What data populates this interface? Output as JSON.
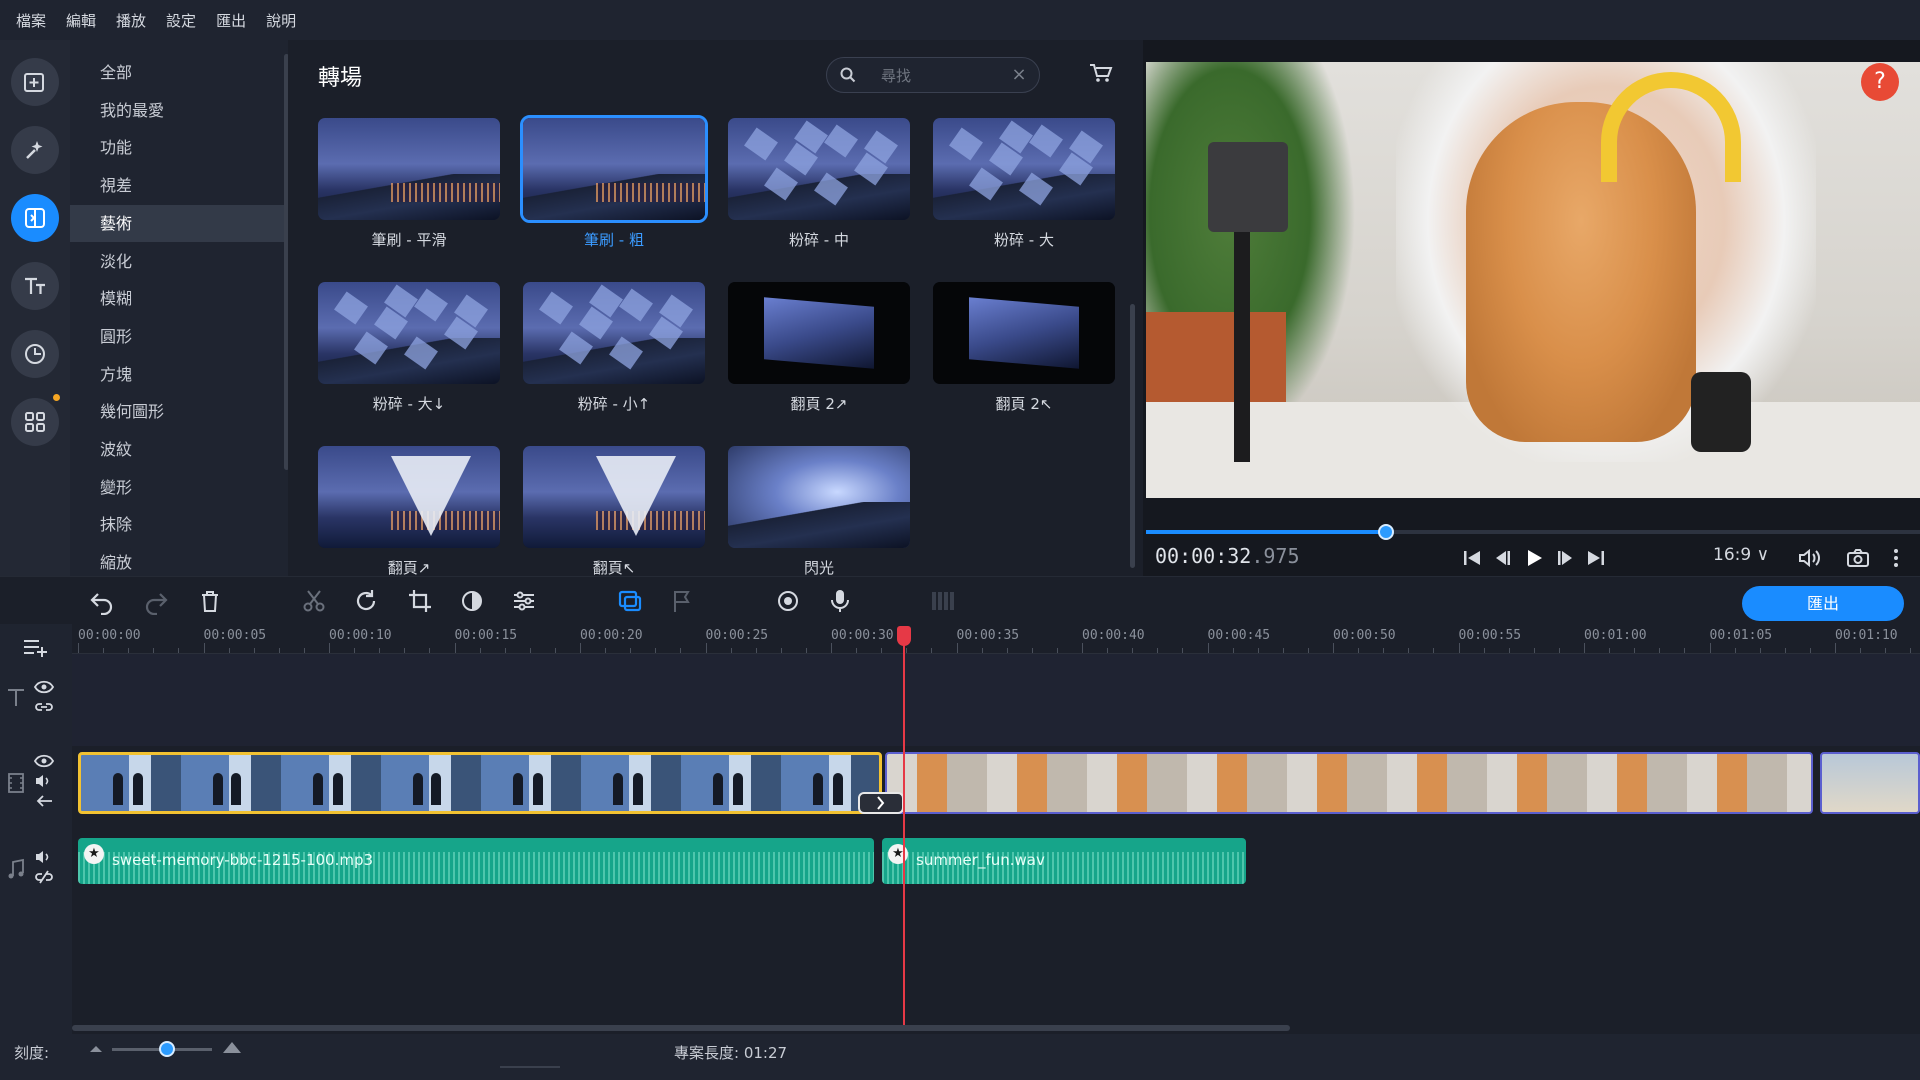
{
  "menu": [
    "檔案",
    "編輯",
    "播放",
    "設定",
    "匯出",
    "說明"
  ],
  "rail": [
    {
      "name": "import-icon",
      "active": false
    },
    {
      "name": "effects-icon",
      "active": false
    },
    {
      "name": "transitions-icon",
      "active": true
    },
    {
      "name": "titles-icon",
      "active": false
    },
    {
      "name": "clock-icon",
      "active": false
    },
    {
      "name": "more-tools-icon",
      "active": false
    }
  ],
  "categories": {
    "items": [
      "全部",
      "我的最愛",
      "功能",
      "視差",
      "藝術",
      "淡化",
      "模糊",
      "圓形",
      "方塊",
      "幾何圖形",
      "波紋",
      "變形",
      "抹除",
      "縮放"
    ],
    "selected_index": 4
  },
  "gallery": {
    "title": "轉場",
    "search_placeholder": "尋找",
    "search_clear": "×",
    "tiles": [
      {
        "label": "筆刷 - 平滑",
        "style": "scene",
        "selected": false
      },
      {
        "label": "筆刷 - 粗",
        "style": "scene",
        "selected": true
      },
      {
        "label": "粉碎 - 中",
        "style": "shatter",
        "selected": false
      },
      {
        "label": "粉碎 - 大",
        "style": "shatter",
        "selected": false
      },
      {
        "label": "粉碎 - 大↓",
        "style": "shatter",
        "selected": false
      },
      {
        "label": "粉碎 - 小↑",
        "style": "shatter",
        "selected": false
      },
      {
        "label": "翻頁 2↗",
        "style": "page",
        "selected": false
      },
      {
        "label": "翻頁 2↖",
        "style": "page",
        "selected": false
      },
      {
        "label": "翻頁↗",
        "style": "wing",
        "selected": false
      },
      {
        "label": "翻頁↖",
        "style": "wing",
        "selected": false
      },
      {
        "label": "閃光",
        "style": "flash",
        "selected": false
      }
    ]
  },
  "preview": {
    "help": "?",
    "timecode_main": "00:00:32",
    "timecode_ms": ".975",
    "seek_progress": 0.31,
    "aspect_ratio": "16:9 ∨"
  },
  "toolbar": {
    "export_label": "匯出"
  },
  "timeline": {
    "ruler_labels": [
      "00:00:00",
      "00:00:05",
      "00:00:10",
      "00:00:15",
      "00:00:20",
      "00:00:25",
      "00:00:30",
      "00:00:35",
      "00:00:40",
      "00:00:45",
      "00:00:50",
      "00:00:55",
      "00:01:00",
      "00:01:05",
      "00:01:10"
    ],
    "audio_clips": [
      "sweet-memory-bbc-1215-100.mp3",
      "summer_fun.wav"
    ]
  },
  "status": {
    "scale_label": "刻度:",
    "project_length": "專案長度:  01:27",
    "zoom_level": 0.55
  },
  "colors": {
    "accent": "#1a8cff",
    "clip_selected_border": "#f2c232",
    "audio_clip": "#16a58a",
    "playhead": "#e63946"
  }
}
